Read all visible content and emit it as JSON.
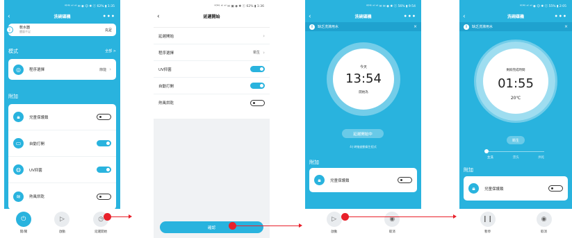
{
  "status_bar": {
    "s1": "ᴴᴰ⁴⁶ ᵃⁱˡ ᵃⁱˡ ✉ ◉ ☺ ✱ ⓒ 62% ▮ 1:35",
    "s2": "ᴴᴰ⁴⁶ ᵃⁱˡ ᵃⁱˡ ✉ ▣ ◉ ✱ ⓒ 62% ▮ 1:36",
    "s3": "ᴴᴰ⁴⁶ ᵃⁱˡ ᵃⁱˡ ✉ ✉ ◉ ✱ ⓒ 56% ▮ 9:54",
    "s4": "ᴴᴰ⁴⁶ ᵃⁱˡ ᵃⁱˡ ◉ ☺ ✱ ⓒ 55% ▮ 2:05"
  },
  "screen1": {
    "title": "洗碗碟機",
    "top_card": {
      "label": "軟水器",
      "sublabel": "鹽量不足",
      "value": "充足"
    },
    "mode_section": {
      "title": "模式",
      "link": "全部 >"
    },
    "program": {
      "label": "程序選擇",
      "value": "節能"
    },
    "addon_section": {
      "title": "附加"
    },
    "addons": [
      {
        "label": "兒童保護鎖",
        "on": false
      },
      {
        "label": "自動打開",
        "on": true
      },
      {
        "label": "UV抑菌",
        "on": true
      },
      {
        "label": "熱風烘乾",
        "on": false
      }
    ],
    "bottom": [
      {
        "label": "開/關"
      },
      {
        "label": "啟動"
      },
      {
        "label": "延遲開始"
      }
    ]
  },
  "screen2": {
    "title": "延遲開始",
    "rows": [
      {
        "label": "延遲開始",
        "value": "",
        "type": "link"
      },
      {
        "label": "程序選擇",
        "value": "衛生",
        "type": "link"
      },
      {
        "label": "UV抑菌",
        "on": true,
        "type": "toggle"
      },
      {
        "label": "自動打開",
        "on": true,
        "type": "toggle"
      },
      {
        "label": "熱風烘乾",
        "on": false,
        "type": "toggle"
      }
    ],
    "confirm": "確認"
  },
  "screen3": {
    "title": "洗碗碟機",
    "notice": "缺乏洗滌用水",
    "dial": {
      "top": "今天",
      "time": "13:54",
      "bottom": "開始為"
    },
    "delay_button": "延遲開始中",
    "delay_note": "4小時後啟動衛生程式",
    "addon_section": "附加",
    "addon": {
      "label": "兒童保護鎖"
    },
    "bottom": [
      {
        "label": "啟動"
      },
      {
        "label": "取消"
      }
    ]
  },
  "screen4": {
    "title": "洗碗碟機",
    "notice": "缺乏洗滌用水",
    "dial": {
      "top": "剩餘完成時間",
      "time": "01:55",
      "temp": "20℃"
    },
    "program": "衛生",
    "stages": [
      "主洗",
      "漂洗",
      "烘乾"
    ],
    "addon_section": "附加",
    "addon": {
      "label": "兒童保護鎖"
    },
    "bottom": [
      {
        "label": "暫停"
      },
      {
        "label": "取消"
      }
    ]
  },
  "colors": {
    "primary": "#29b3de",
    "notice": "#1fa2cf",
    "arrow": "#e8202a"
  }
}
